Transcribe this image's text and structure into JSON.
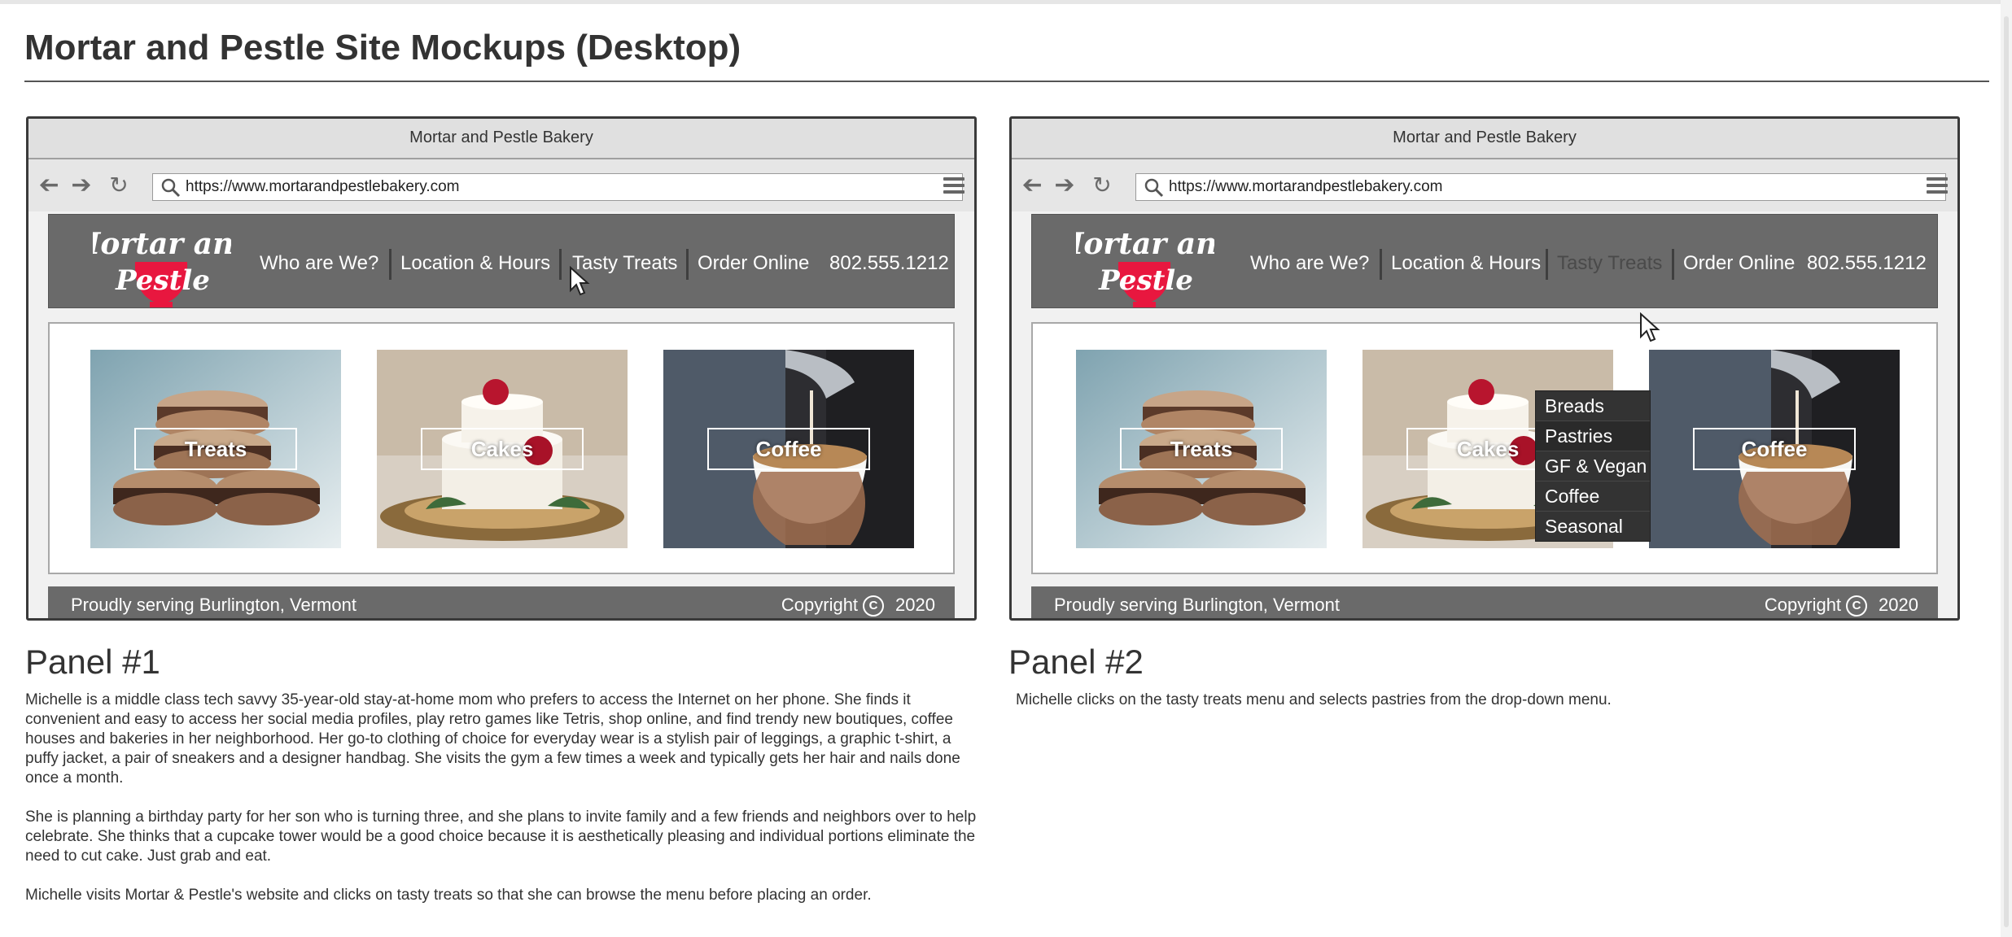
{
  "page": {
    "title": "Mortar and Pestle Site Mockups (Desktop)"
  },
  "browser": {
    "window_title": "Mortar and Pestle Bakery",
    "url": "https://www.mortarandpestlebakery.com",
    "icons": [
      "back-arrow-icon",
      "forward-arrow-icon",
      "reload-icon",
      "search-icon",
      "hamburger-menu-icon"
    ]
  },
  "site": {
    "logo_line1": "Mortar and",
    "logo_line2": "Pestle",
    "brand_color": "#e8173f",
    "nav": [
      "Who are We?",
      "Location & Hours",
      "Tasty Treats",
      "Order Online"
    ],
    "phone": "802.555.1212",
    "tiles": [
      "Treats",
      "Cakes",
      "Coffee"
    ],
    "footer_left": "Proudly serving Burlington, Vermont",
    "footer_copyright": "Copyright",
    "footer_year": "2020",
    "dropdown": [
      "Breads",
      "Pastries",
      "GF & Vegan",
      "Coffee",
      "Seasonal"
    ]
  },
  "panels": [
    {
      "title": "Panel #1",
      "paragraphs": [
        "Michelle is a middle class tech savvy 35-year-old stay-at-home mom who prefers to access the Internet on her phone. She finds it convenient and easy to access her social media profiles, play retro games like Tetris, shop online, and find trendy new boutiques, coffee houses and bakeries in her neighborhood. Her go-to clothing of choice for everyday wear is a stylish pair of leggings, a graphic t-shirt, a puffy jacket, a pair of sneakers and a designer handbag. She visits the gym a few times a week and typically gets her hair and nails done once a month.",
        "She is planning a birthday party for her son who is turning three, and she plans to invite family and a few friends and neighbors over to help celebrate. She thinks that a cupcake tower would be a good choice because it is aesthetically pleasing and individual portions eliminate the need to cut cake. Just grab and eat.",
        "Michelle visits Mortar & Pestle's website and clicks on tasty treats so that she can browse the menu before placing an order."
      ]
    },
    {
      "title": "Panel #2",
      "paragraphs": [
        "Michelle clicks on the tasty treats menu and selects pastries from the drop-down menu."
      ]
    }
  ]
}
